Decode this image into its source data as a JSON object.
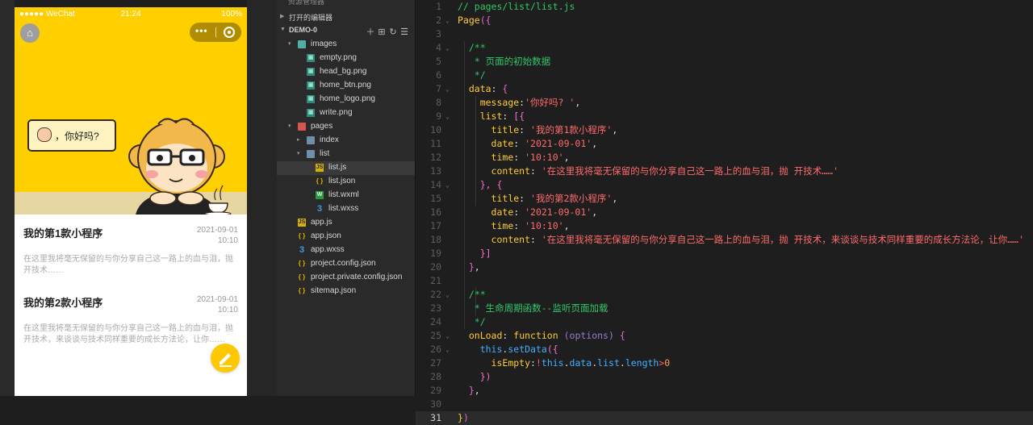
{
  "status_bar": {
    "carrier": "●●●●● WeChat",
    "time": "21:24",
    "battery": "100%"
  },
  "capsule": {
    "menu_icon": "more-dots-icon",
    "close_icon": "target-icon"
  },
  "hero": {
    "bubble_text": "，你好吗?"
  },
  "list": [
    {
      "title": "我的第1款小程序",
      "date": "2021-09-01",
      "time": "10:10",
      "content": "在这里我将毫无保留的与你分享自己这一路上的血与泪，抛开技术……"
    },
    {
      "title": "我的第2款小程序",
      "date": "2021-09-01",
      "time": "10:10",
      "content": "在这里我将毫无保留的与你分享自己这一路上的血与泪，抛开技术，来谈谈与技术同样重要的成长方法论，让你……"
    }
  ],
  "explorer": {
    "top_label": "资源管理器",
    "open_editors": "打开的编辑器",
    "project": "DEMO-0",
    "toolbar": [
      "new-file-icon",
      "new-folder-icon",
      "refresh-icon",
      "collapse-icon"
    ],
    "tree": [
      {
        "name": "images",
        "icon": "folder-img",
        "depth": 1,
        "tri": "▾"
      },
      {
        "name": "empty.png",
        "icon": "img",
        "depth": 2
      },
      {
        "name": "head_bg.png",
        "icon": "img",
        "depth": 2
      },
      {
        "name": "home_btn.png",
        "icon": "img",
        "depth": 2
      },
      {
        "name": "home_logo.png",
        "icon": "img",
        "depth": 2
      },
      {
        "name": "write.png",
        "icon": "img",
        "depth": 2
      },
      {
        "name": "pages",
        "icon": "folder-red",
        "depth": 1,
        "tri": "▾"
      },
      {
        "name": "index",
        "icon": "folder",
        "depth": 2,
        "tri": "▸"
      },
      {
        "name": "list",
        "icon": "folder",
        "depth": 2,
        "tri": "▾"
      },
      {
        "name": "list.js",
        "icon": "js",
        "depth": 3,
        "selected": true
      },
      {
        "name": "list.json",
        "icon": "json",
        "depth": 3
      },
      {
        "name": "list.wxml",
        "icon": "wxml",
        "depth": 3
      },
      {
        "name": "list.wxss",
        "icon": "wxss",
        "depth": 3
      },
      {
        "name": "app.js",
        "icon": "js",
        "depth": 1
      },
      {
        "name": "app.json",
        "icon": "json",
        "depth": 1
      },
      {
        "name": "app.wxss",
        "icon": "wxss",
        "depth": 1
      },
      {
        "name": "project.config.json",
        "icon": "json",
        "depth": 1
      },
      {
        "name": "project.private.config.json",
        "icon": "json",
        "depth": 1
      },
      {
        "name": "sitemap.json",
        "icon": "json",
        "depth": 1
      }
    ]
  },
  "editor": {
    "active_line": 31,
    "lines": [
      {
        "n": 1,
        "fold": "",
        "tokens": [
          [
            "cm",
            "// pages/list/list.js"
          ]
        ]
      },
      {
        "n": 2,
        "fold": "⌄",
        "tokens": [
          [
            "fn",
            "Page"
          ],
          [
            "pr",
            "({"
          ]
        ]
      },
      {
        "n": 3,
        "fold": "",
        "tokens": []
      },
      {
        "n": 4,
        "fold": "⌄",
        "tokens": [
          [
            "p",
            "  "
          ],
          [
            "cm",
            "/**"
          ]
        ]
      },
      {
        "n": 5,
        "fold": "",
        "tokens": [
          [
            "cm",
            "   * 页面的初始数据"
          ]
        ]
      },
      {
        "n": 6,
        "fold": "",
        "tokens": [
          [
            "cm",
            "   */"
          ]
        ]
      },
      {
        "n": 7,
        "fold": "⌄",
        "tokens": [
          [
            "p",
            "  "
          ],
          [
            "k",
            "data"
          ],
          [
            "p",
            ": "
          ],
          [
            "pr",
            "{"
          ]
        ]
      },
      {
        "n": 8,
        "fold": "",
        "tokens": [
          [
            "p",
            "    "
          ],
          [
            "k",
            "message"
          ],
          [
            "p",
            ":"
          ],
          [
            "s",
            "'你好吗? '"
          ],
          [
            "p",
            ","
          ]
        ]
      },
      {
        "n": 9,
        "fold": "⌄",
        "tokens": [
          [
            "p",
            "    "
          ],
          [
            "k",
            "list"
          ],
          [
            "p",
            ": "
          ],
          [
            "br",
            "[{"
          ]
        ]
      },
      {
        "n": 10,
        "fold": "",
        "tokens": [
          [
            "p",
            "      "
          ],
          [
            "k",
            "title"
          ],
          [
            "p",
            ": "
          ],
          [
            "s",
            "'我的第1款小程序'"
          ],
          [
            "p",
            ","
          ]
        ]
      },
      {
        "n": 11,
        "fold": "",
        "tokens": [
          [
            "p",
            "      "
          ],
          [
            "k",
            "date"
          ],
          [
            "p",
            ": "
          ],
          [
            "s",
            "'2021-09-01'"
          ],
          [
            "p",
            ","
          ]
        ]
      },
      {
        "n": 12,
        "fold": "",
        "tokens": [
          [
            "p",
            "      "
          ],
          [
            "k",
            "time"
          ],
          [
            "p",
            ": "
          ],
          [
            "s",
            "'10:10'"
          ],
          [
            "p",
            ","
          ]
        ]
      },
      {
        "n": 13,
        "fold": "",
        "tokens": [
          [
            "p",
            "      "
          ],
          [
            "k",
            "content"
          ],
          [
            "p",
            ": "
          ],
          [
            "s",
            "'在这里我将毫无保留的与你分享自己这一路上的血与泪，抛 开技术……'"
          ]
        ]
      },
      {
        "n": 14,
        "fold": "⌄",
        "tokens": [
          [
            "p",
            "    "
          ],
          [
            "br",
            "}, {"
          ]
        ]
      },
      {
        "n": 15,
        "fold": "",
        "tokens": [
          [
            "p",
            "      "
          ],
          [
            "k",
            "title"
          ],
          [
            "p",
            ": "
          ],
          [
            "s",
            "'我的第2款小程序'"
          ],
          [
            "p",
            ","
          ]
        ]
      },
      {
        "n": 16,
        "fold": "",
        "tokens": [
          [
            "p",
            "      "
          ],
          [
            "k",
            "date"
          ],
          [
            "p",
            ": "
          ],
          [
            "s",
            "'2021-09-01'"
          ],
          [
            "p",
            ","
          ]
        ]
      },
      {
        "n": 17,
        "fold": "",
        "tokens": [
          [
            "p",
            "      "
          ],
          [
            "k",
            "time"
          ],
          [
            "p",
            ": "
          ],
          [
            "s",
            "'10:10'"
          ],
          [
            "p",
            ","
          ]
        ]
      },
      {
        "n": 18,
        "fold": "",
        "tokens": [
          [
            "p",
            "      "
          ],
          [
            "k",
            "content"
          ],
          [
            "p",
            ": "
          ],
          [
            "s",
            "'在这里我将毫无保留的与你分享自己这一路上的血与泪，抛 开技术，来谈谈与技术同样重要的成长方法论，让你……'"
          ]
        ]
      },
      {
        "n": 19,
        "fold": "",
        "tokens": [
          [
            "p",
            "    "
          ],
          [
            "br",
            "}]"
          ]
        ]
      },
      {
        "n": 20,
        "fold": "",
        "tokens": [
          [
            "p",
            "  "
          ],
          [
            "pr",
            "}"
          ],
          [
            "p",
            ","
          ]
        ]
      },
      {
        "n": 21,
        "fold": "",
        "tokens": []
      },
      {
        "n": 22,
        "fold": "⌄",
        "tokens": [
          [
            "p",
            "  "
          ],
          [
            "cm",
            "/**"
          ]
        ]
      },
      {
        "n": 23,
        "fold": "",
        "tokens": [
          [
            "cm",
            "   * 生命周期函数--监听页面加载"
          ]
        ]
      },
      {
        "n": 24,
        "fold": "",
        "tokens": [
          [
            "cm",
            "   */"
          ]
        ]
      },
      {
        "n": 25,
        "fold": "⌄",
        "tokens": [
          [
            "p",
            "  "
          ],
          [
            "k",
            "onLoad"
          ],
          [
            "p",
            ": "
          ],
          [
            "kw",
            "function"
          ],
          [
            "p",
            " "
          ],
          [
            "arg",
            "(options)"
          ],
          [
            "p",
            " "
          ],
          [
            "pr",
            "{"
          ]
        ]
      },
      {
        "n": 26,
        "fold": "⌄",
        "tokens": [
          [
            "p",
            "    "
          ],
          [
            "th",
            "this"
          ],
          [
            "p",
            "."
          ],
          [
            "th",
            "setData"
          ],
          [
            "br",
            "({"
          ]
        ]
      },
      {
        "n": 27,
        "fold": "",
        "tokens": [
          [
            "p",
            "      "
          ],
          [
            "k",
            "isEmpty"
          ],
          [
            "p",
            ":"
          ],
          [
            "op",
            "!"
          ],
          [
            "th",
            "this"
          ],
          [
            "p",
            "."
          ],
          [
            "th",
            "data"
          ],
          [
            "p",
            "."
          ],
          [
            "th",
            "list"
          ],
          [
            "p",
            "."
          ],
          [
            "th",
            "length"
          ],
          [
            "op",
            ">"
          ],
          [
            "n",
            "0"
          ]
        ]
      },
      {
        "n": 28,
        "fold": "",
        "tokens": [
          [
            "p",
            "    "
          ],
          [
            "br",
            "})"
          ]
        ]
      },
      {
        "n": 29,
        "fold": "",
        "tokens": [
          [
            "p",
            "  "
          ],
          [
            "pr",
            "}"
          ],
          [
            "p",
            ","
          ]
        ]
      },
      {
        "n": 30,
        "fold": "",
        "tokens": []
      },
      {
        "n": 31,
        "fold": "",
        "tokens": [
          [
            "fn",
            "}"
          ],
          [
            "pr",
            ")"
          ]
        ]
      }
    ]
  }
}
